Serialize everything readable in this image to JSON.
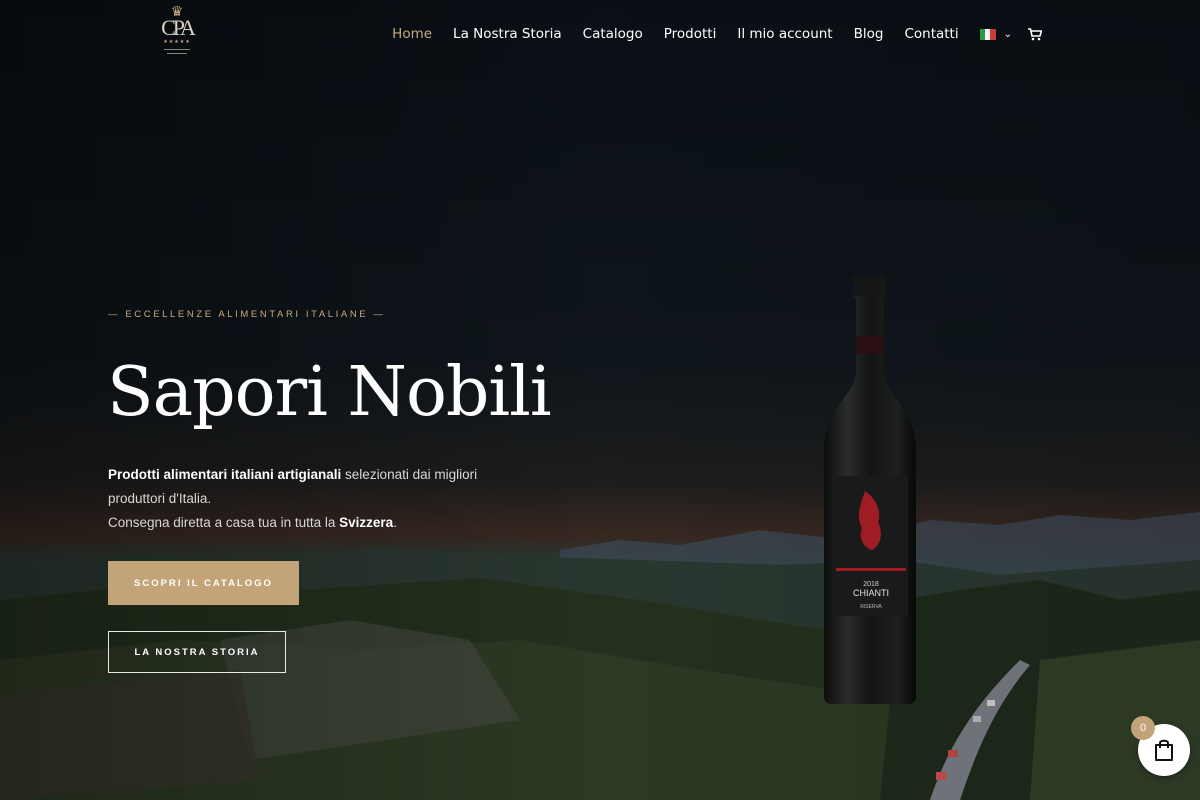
{
  "header": {
    "logo": {
      "mark": "CPA",
      "stars": "★★★★★"
    },
    "nav": [
      {
        "label": "Home",
        "active": true
      },
      {
        "label": "La Nostra Storia"
      },
      {
        "label": "Catalogo"
      },
      {
        "label": "Prodotti"
      },
      {
        "label": "Il mio account"
      },
      {
        "label": "Blog"
      },
      {
        "label": "Contatti"
      }
    ],
    "language_flag": "italian-flag-icon",
    "cart_icon": "cart-icon"
  },
  "hero": {
    "eyebrow": "— ECCELLENZE ALIMENTARI ITALIANE —",
    "title": "Sapori Nobili",
    "desc_bold1": "Prodotti alimentari italiani artigianali",
    "desc_text1": " selezionati dai migliori produttori d'Italia.",
    "desc_text2": "Consegna diretta a casa tua in tutta la ",
    "desc_bold2": "Svizzera",
    "desc_end": ".",
    "primary_button": "SCOPRI IL CATALOGO",
    "secondary_button": "LA NOSTRA STORIA"
  },
  "bottle": {
    "year": "2018",
    "name": "CHIANTI",
    "sub": "RISERVA"
  },
  "floating_cart": {
    "count": "0",
    "icon": "shopping-bag-icon"
  },
  "colors": {
    "accent": "#c2a478",
    "background": "#0b1118"
  }
}
